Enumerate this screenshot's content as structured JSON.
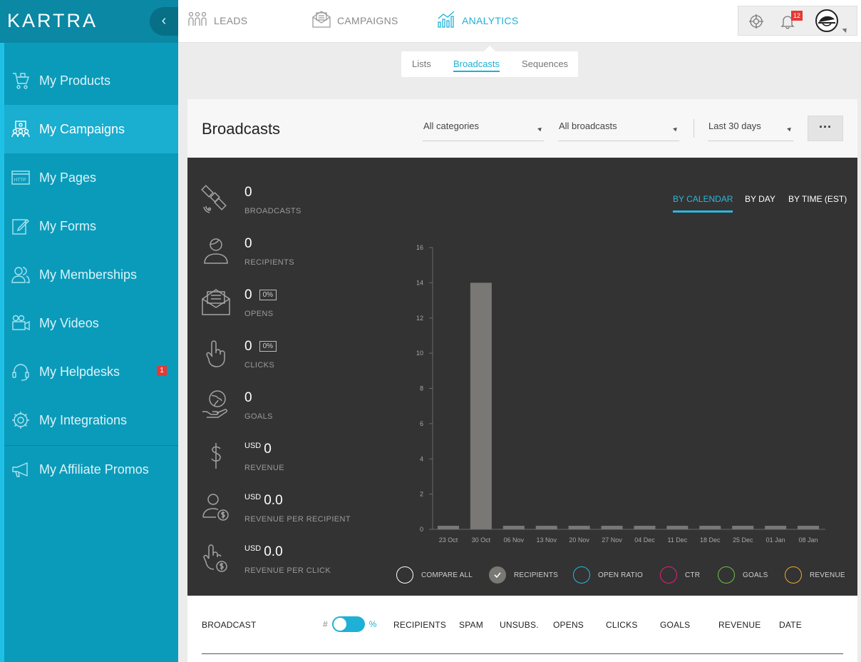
{
  "app": {
    "logo": "KARTRA"
  },
  "sidebar": {
    "collapse_glyph": "‹",
    "items": [
      {
        "label": "My Products",
        "icon": "cart-icon"
      },
      {
        "label": "My Campaigns",
        "icon": "campaigns-icon",
        "active": true
      },
      {
        "label": "My Pages",
        "icon": "http-icon"
      },
      {
        "label": "My Forms",
        "icon": "form-edit-icon"
      },
      {
        "label": "My Memberships",
        "icon": "members-icon"
      },
      {
        "label": "My Videos",
        "icon": "video-camera-icon"
      },
      {
        "label": "My Helpdesks",
        "icon": "headset-icon",
        "badge": "1"
      },
      {
        "label": "My Integrations",
        "icon": "gear-icon"
      },
      {
        "label": "My Affiliate Promos",
        "icon": "megaphone-icon"
      }
    ]
  },
  "topnav": {
    "items": [
      {
        "label": "LEADS",
        "icon": "people-icon"
      },
      {
        "label": "CAMPAIGNS",
        "icon": "envelope-open-icon"
      },
      {
        "label": "ANALYTICS",
        "icon": "bar-chart-icon",
        "active": true
      }
    ],
    "notifications_count": "12"
  },
  "subtabs": {
    "items": [
      {
        "label": "Lists"
      },
      {
        "label": "Broadcasts",
        "active": true
      },
      {
        "label": "Sequences"
      }
    ]
  },
  "header": {
    "title": "Broadcasts",
    "filters": {
      "category": "All categories",
      "broadcast": "All broadcasts",
      "period": "Last 30 days"
    },
    "more_label": "···"
  },
  "stats": [
    {
      "value": "0",
      "label": "BROADCASTS",
      "icon": "satellite-icon"
    },
    {
      "value": "0",
      "label": "RECIPIENTS",
      "icon": "user-icon"
    },
    {
      "value": "0",
      "label": "OPENS",
      "pct": "0%",
      "icon": "open-envelope-icon"
    },
    {
      "value": "0",
      "label": "CLICKS",
      "pct": "0%",
      "icon": "pointer-hand-icon"
    },
    {
      "value": "0",
      "label": "GOALS",
      "icon": "globe-hand-icon"
    },
    {
      "value": "0",
      "currency": "USD",
      "label": "REVENUE",
      "icon": "dollar-icon"
    },
    {
      "value": "0.0",
      "currency": "USD",
      "label": "REVENUE PER RECIPIENT",
      "icon": "user-dollar-icon"
    },
    {
      "value": "0.0",
      "currency": "USD",
      "label": "REVENUE PER CLICK",
      "icon": "hand-dollar-icon"
    }
  ],
  "chart_tabs": [
    {
      "label": "BY CALENDAR",
      "active": true
    },
    {
      "label": "BY DAY"
    },
    {
      "label": "BY TIME (EST)"
    }
  ],
  "chart_data": {
    "type": "bar",
    "categories": [
      "23 Oct",
      "30 Oct",
      "06 Nov",
      "13 Nov",
      "20 Nov",
      "27 Nov",
      "04 Dec",
      "11 Dec",
      "18 Dec",
      "25 Dec",
      "01 Jan",
      "08 Jan"
    ],
    "series": [
      {
        "name": "RECIPIENTS",
        "values": [
          0.2,
          14,
          0.2,
          0.2,
          0.2,
          0.2,
          0.2,
          0.2,
          0.2,
          0.2,
          0.2,
          0.2
        ]
      }
    ],
    "ylim": [
      0,
      16
    ],
    "yticks": [
      0,
      2,
      4,
      6,
      8,
      10,
      12,
      14,
      16
    ],
    "bar_color": "#7a7874",
    "grid": false
  },
  "legend": [
    {
      "label": "COMPARE ALL",
      "color": "#ffffff",
      "checked": false
    },
    {
      "label": "RECIPIENTS",
      "color": "#7a7874",
      "checked": true
    },
    {
      "label": "OPEN RATIO",
      "color": "#28b8e0",
      "checked": false
    },
    {
      "label": "CTR",
      "color": "#e0207a",
      "checked": false
    },
    {
      "label": "GOALS",
      "color": "#6cc04a",
      "checked": false
    },
    {
      "label": "REVENUE",
      "color": "#f0a830",
      "checked": false
    }
  ],
  "table": {
    "columns": [
      "BROADCAST",
      "RECIPIENTS",
      "SPAM",
      "UNSUBS.",
      "OPENS",
      "CLICKS",
      "GOALS",
      "REVENUE",
      "DATE"
    ],
    "toggle_left": "#",
    "toggle_right": "%"
  },
  "colors": {
    "accent": "#1fb0d6",
    "sidebar": "#0b9bba",
    "dark_panel": "#333333"
  }
}
